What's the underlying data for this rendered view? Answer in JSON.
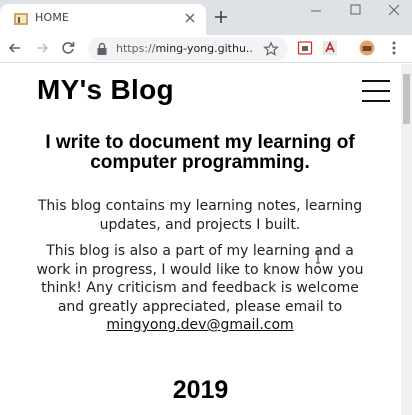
{
  "browser": {
    "tab_title": "HOME",
    "url_scheme": "https://",
    "url_host": "ming-yong.githu..."
  },
  "page": {
    "brand": "MY's Blog",
    "heading": "I write to document my learning of computer programming.",
    "intro": "This blog contains my learning notes, learning updates, and projects I built.",
    "note_prefix": "This blog is also a part of my learning and a work in progress, I would like to know how you think! Any criticism and feedback is welcome and greatly appreciated, please email to",
    "email": "mingyong.dev@gmail.com",
    "year": "2019"
  },
  "colors": {
    "tabstrip": "#dee1e6",
    "omnibox": "#f1f3f4",
    "text": "#000000"
  },
  "icons": [
    "favicon-icon",
    "close-icon",
    "plus-icon",
    "minimize-icon",
    "maximize-icon",
    "window-close-icon",
    "back-icon",
    "forward-icon",
    "reload-icon",
    "lock-icon",
    "star-icon",
    "extension-icon",
    "pdf-extension-icon",
    "profile-icon",
    "menu-kebab-icon",
    "hamburger-icon"
  ]
}
